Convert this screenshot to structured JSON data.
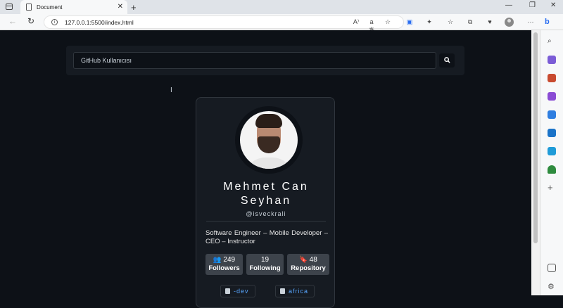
{
  "browser": {
    "tab_title": "Document",
    "tab_close": "✕",
    "new_tab": "+",
    "window_controls": [
      "—",
      "❐",
      "✕"
    ],
    "address": "127.0.0.1:5500/index.html",
    "nav": {
      "back": "←",
      "reload": "↻"
    },
    "toolbar_icons": [
      "read-aloud-icon",
      "translate-icon",
      "favorites-add-icon",
      "screen-cast-icon",
      "extensions-icon",
      "favorites-icon",
      "collections-icon",
      "health-icon",
      "profile-icon",
      "bing-icon"
    ],
    "read_aloud_label": "A⁾",
    "translate_label": "aあ",
    "bing_label": "b"
  },
  "search": {
    "placeholder": "GitHub Kullanıcısı",
    "button_icon": "search-icon"
  },
  "profile": {
    "name": "Mehmet Can Seyhan",
    "handle": "@isveckrali",
    "bio": "Software Engineer – Mobile Developer – CEO – Instructor",
    "stats": [
      {
        "icon": "users-icon",
        "value": "249",
        "label": "Followers"
      },
      {
        "icon": "",
        "value": "19",
        "label": "Following"
      },
      {
        "icon": "bookmark-icon",
        "value": "48",
        "label": "Repository"
      }
    ],
    "repos": [
      "-dev",
      "africa"
    ]
  }
}
